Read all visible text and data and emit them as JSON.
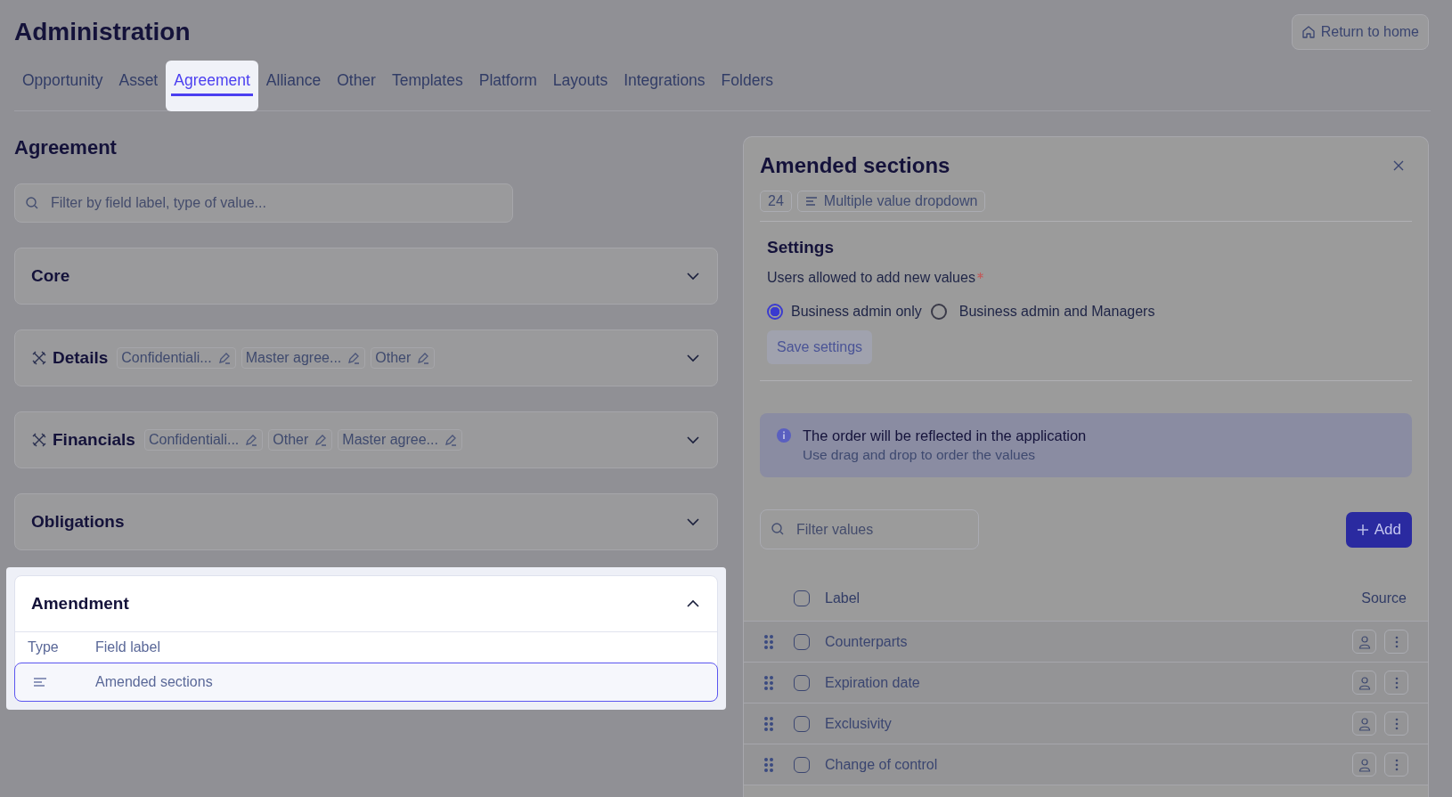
{
  "header": {
    "title": "Administration",
    "home_button": "Return to home"
  },
  "tabs": [
    {
      "label": "Opportunity",
      "selected": false
    },
    {
      "label": "Asset",
      "selected": false
    },
    {
      "label": "Agreement",
      "selected": true
    },
    {
      "label": "Alliance",
      "selected": false
    },
    {
      "label": "Other",
      "selected": false
    },
    {
      "label": "Templates",
      "selected": false
    },
    {
      "label": "Platform",
      "selected": false
    },
    {
      "label": "Layouts",
      "selected": false
    },
    {
      "label": "Integrations",
      "selected": false
    },
    {
      "label": "Folders",
      "selected": false
    }
  ],
  "page_title": "Agreement",
  "filter": {
    "placeholder": "Filter by field label, type of value..."
  },
  "sections": [
    {
      "title": "Core",
      "expanded": false
    },
    {
      "title": "Details",
      "expanded": false,
      "tags": [
        "Confidentiali...",
        "Master agree...",
        "Other"
      ]
    },
    {
      "title": "Financials",
      "expanded": false,
      "tags": [
        "Confidentiali...",
        "Other",
        "Master agree..."
      ]
    },
    {
      "title": "Obligations",
      "expanded": false
    },
    {
      "title": "Amendment",
      "expanded": true,
      "columns": [
        "Type",
        "Field label"
      ],
      "rows": [
        {
          "label": "Amended sections",
          "selected": true
        }
      ]
    }
  ],
  "panel": {
    "title": "Amended sections",
    "count": "24",
    "type": "Multiple value dropdown",
    "settings_title": "Settings",
    "field_label": "Users allowed to add new values",
    "required": true,
    "options": [
      {
        "label": "Business admin only",
        "selected": true
      },
      {
        "label": "Business admin and Managers",
        "selected": false
      }
    ],
    "save_button": {
      "label": "Save  settings",
      "disabled": true
    },
    "info": {
      "title": "The order will be reflected in the application",
      "text": "Use drag and drop to order the values"
    },
    "values_filter": {
      "placeholder": "Filter values"
    },
    "add_button": "Add",
    "columns": [
      "Label",
      "Source"
    ],
    "select_all_checked": false,
    "rows": [
      {
        "label": "Counterparts",
        "checked": false
      },
      {
        "label": "Expiration date",
        "checked": false
      },
      {
        "label": "Exclusivity",
        "checked": false
      },
      {
        "label": "Change of control",
        "checked": false
      }
    ]
  }
}
